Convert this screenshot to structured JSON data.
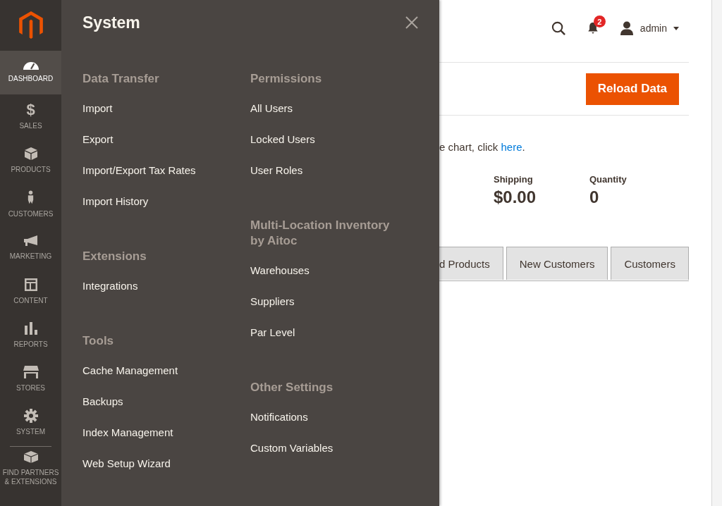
{
  "sidebar": {
    "items": [
      {
        "label": "DASHBOARD",
        "selected": true
      },
      {
        "label": "SALES",
        "selected": false,
        "glyph": "$"
      },
      {
        "label": "PRODUCTS",
        "selected": false
      },
      {
        "label": "CUSTOMERS",
        "selected": false
      },
      {
        "label": "MARKETING",
        "selected": false
      },
      {
        "label": "CONTENT",
        "selected": false
      },
      {
        "label": "REPORTS",
        "selected": false
      },
      {
        "label": "STORES",
        "selected": false
      },
      {
        "label": "SYSTEM",
        "selected": false
      },
      {
        "label": "FIND PARTNERS & EXTENSIONS",
        "selected": false
      }
    ]
  },
  "menu": {
    "title": "System",
    "columns": [
      [
        {
          "heading": "Data Transfer",
          "items": [
            "Import",
            "Export",
            "Import/Export Tax Rates",
            "Import History"
          ]
        },
        {
          "heading": "Extensions",
          "items": [
            "Integrations"
          ]
        },
        {
          "heading": "Tools",
          "items": [
            "Cache Management",
            "Backups",
            "Index Management",
            "Web Setup Wizard"
          ]
        }
      ],
      [
        {
          "heading": "Permissions",
          "items": [
            "All Users",
            "Locked Users",
            "User Roles"
          ]
        },
        {
          "heading": "Multi-Location Inventory by Aitoc",
          "items": [
            "Warehouses",
            "Suppliers",
            "Par Level"
          ]
        },
        {
          "heading": "Other Settings",
          "items": [
            "Notifications",
            "Custom Variables"
          ]
        }
      ]
    ]
  },
  "header": {
    "notifications": "2",
    "user": "admin"
  },
  "page": {
    "action": "Reload Data",
    "chart_hint": {
      "text": "e chart, click ",
      "link": "here",
      "end": "."
    },
    "stats": [
      {
        "label": "Shipping",
        "value": "$0.00"
      },
      {
        "label": "Quantity",
        "value": "0"
      }
    ],
    "tabs": [
      {
        "label": "d Products",
        "selected": false
      },
      {
        "label": "New Customers",
        "selected": false
      },
      {
        "label": "Customers",
        "selected": false
      }
    ]
  }
}
